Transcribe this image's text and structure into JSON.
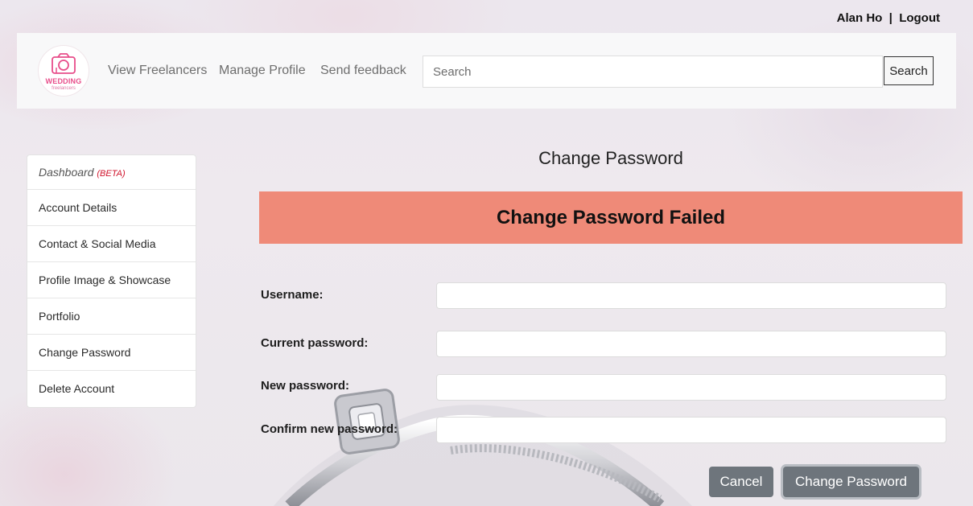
{
  "user": {
    "name": "Alan Ho",
    "separator": "  |  ",
    "logout_label": "Logout"
  },
  "logo": {
    "brand": "WEDDING",
    "sub": "freelancers"
  },
  "nav": {
    "links": [
      "View Freelancers",
      "Manage Profile",
      "Send feedback"
    ],
    "search_placeholder": "Search",
    "search_button": "Search"
  },
  "sidebar": {
    "items": [
      {
        "label": "Dashboard",
        "badge": "(BETA)"
      },
      {
        "label": "Account Details"
      },
      {
        "label": "Contact & Social Media"
      },
      {
        "label": "Profile Image & Showcase"
      },
      {
        "label": "Portfolio"
      },
      {
        "label": "Change Password"
      },
      {
        "label": "Delete Account"
      }
    ]
  },
  "main": {
    "title": "Change Password",
    "alert": "Change Password Failed",
    "fields": [
      {
        "label": "Username:",
        "value": ""
      },
      {
        "label": "Current password:",
        "value": ""
      },
      {
        "label": "New password:",
        "value": ""
      },
      {
        "label": "Confirm new password:",
        "value": ""
      }
    ],
    "cancel_label": "Cancel",
    "submit_label": "Change Password"
  },
  "colors": {
    "alert_bg": "#ef8a78",
    "brand_pink": "#e84d8a",
    "button_gray": "#6e757c",
    "beta_red": "#d0142c"
  }
}
